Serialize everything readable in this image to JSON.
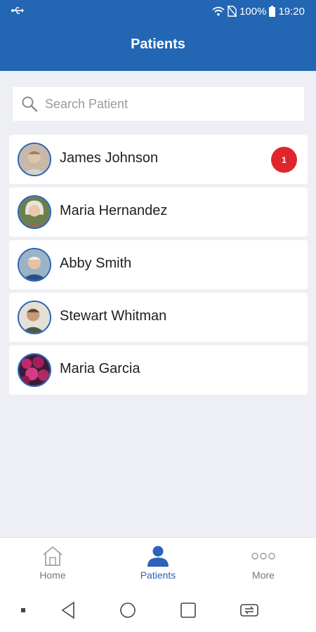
{
  "status": {
    "battery": "100%",
    "time": "19:20"
  },
  "header": {
    "title": "Patients"
  },
  "search": {
    "placeholder": "Search Patient"
  },
  "patients": [
    {
      "name": "James Johnson",
      "unread": "1"
    },
    {
      "name": "Maria Hernandez"
    },
    {
      "name": "Abby Smith"
    },
    {
      "name": "Stewart Whitman"
    },
    {
      "name": "Maria Garcia"
    }
  ],
  "tabs": [
    {
      "label": "Home",
      "icon": "home-icon"
    },
    {
      "label": "Patients",
      "icon": "person-icon"
    },
    {
      "label": "More",
      "icon": "more-icon"
    }
  ],
  "colors": {
    "brand": "#2266b4",
    "badge": "#e0262d",
    "background": "#eeeff4"
  }
}
